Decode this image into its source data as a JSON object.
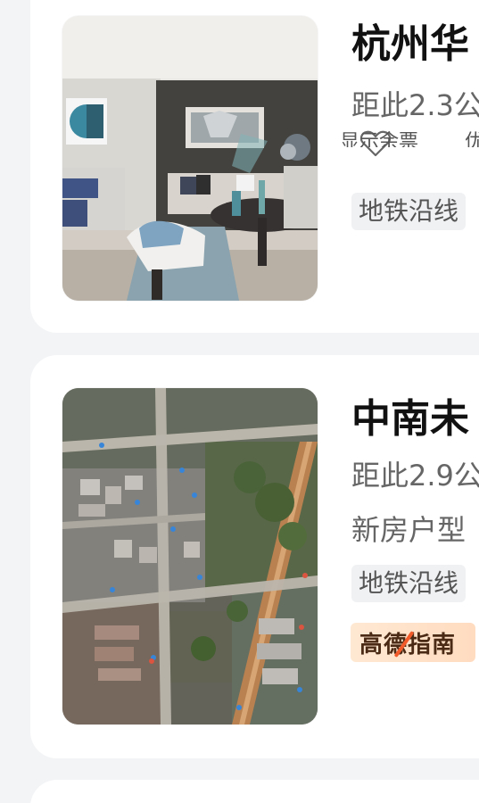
{
  "listings": [
    {
      "title": "杭州华",
      "distance": "距此2.3公",
      "actions": {
        "left_label": "显示余票",
        "right_label": "优"
      },
      "tag": "地铁沿线",
      "image_icon": "interior-room-photo"
    },
    {
      "title": "中南未",
      "distance": "距此2.9公",
      "subline": "新房户型",
      "tag": "地铁沿线",
      "badge": "高德指南",
      "image_icon": "satellite-map-photo"
    }
  ],
  "colors": {
    "page_bg": "#f3f4f6",
    "card_bg": "#ffffff",
    "title": "#111111",
    "meta": "#666666",
    "tag_bg": "#f0f1f3",
    "badge_accent": "#f25a2a"
  }
}
